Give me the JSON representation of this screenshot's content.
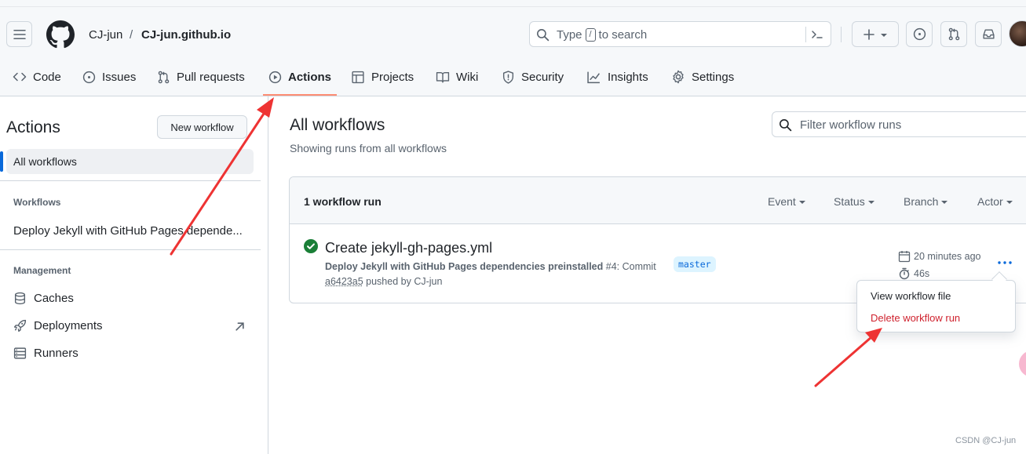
{
  "header": {
    "owner": "CJ-jun",
    "separator": "/",
    "repo": "CJ-jun.github.io",
    "search": {
      "prefix": "Type",
      "key": "/",
      "suffix": "to search"
    }
  },
  "nav": {
    "tabs": [
      {
        "label": "Code",
        "icon": "code-icon"
      },
      {
        "label": "Issues",
        "icon": "issue-icon"
      },
      {
        "label": "Pull requests",
        "icon": "pull-request-icon"
      },
      {
        "label": "Actions",
        "icon": "play-icon",
        "active": true
      },
      {
        "label": "Projects",
        "icon": "table-icon"
      },
      {
        "label": "Wiki",
        "icon": "book-icon"
      },
      {
        "label": "Security",
        "icon": "shield-icon"
      },
      {
        "label": "Insights",
        "icon": "graph-icon"
      },
      {
        "label": "Settings",
        "icon": "gear-icon"
      }
    ]
  },
  "sidebar": {
    "title": "Actions",
    "new_workflow": "New workflow",
    "all_workflows": "All workflows",
    "workflows_heading": "Workflows",
    "workflow_item": "Deploy Jekyll with GitHub Pages depende...",
    "management_heading": "Management",
    "management": [
      {
        "label": "Caches",
        "icon": "database-icon"
      },
      {
        "label": "Deployments",
        "icon": "rocket-icon"
      },
      {
        "label": "Runners",
        "icon": "server-icon"
      }
    ]
  },
  "main": {
    "title": "All workflows",
    "subtitle": "Showing runs from all workflows",
    "filter_placeholder": "Filter workflow runs",
    "runs_count": "1 workflow run",
    "filters": [
      "Event",
      "Status",
      "Branch",
      "Actor"
    ],
    "run": {
      "title": "Create jekyll-gh-pages.yml",
      "workflow": "Deploy Jekyll with GitHub Pages dependencies preinstalled",
      "number": "#4: Commit",
      "sha": "a6423a5",
      "pushed_by": "pushed by CJ-jun",
      "branch": "master",
      "time_ago": "20 minutes ago",
      "duration": "46s",
      "status": "success"
    },
    "menu": {
      "view": "View workflow file",
      "delete": "Delete workflow run"
    }
  },
  "watermark": "CSDN @CJ-jun",
  "colors": {
    "accent": "#0969da",
    "success": "#1a7f37",
    "danger": "#cf222e",
    "tab_underline": "#fd8c73",
    "annotation_arrow": "#ee3333"
  }
}
